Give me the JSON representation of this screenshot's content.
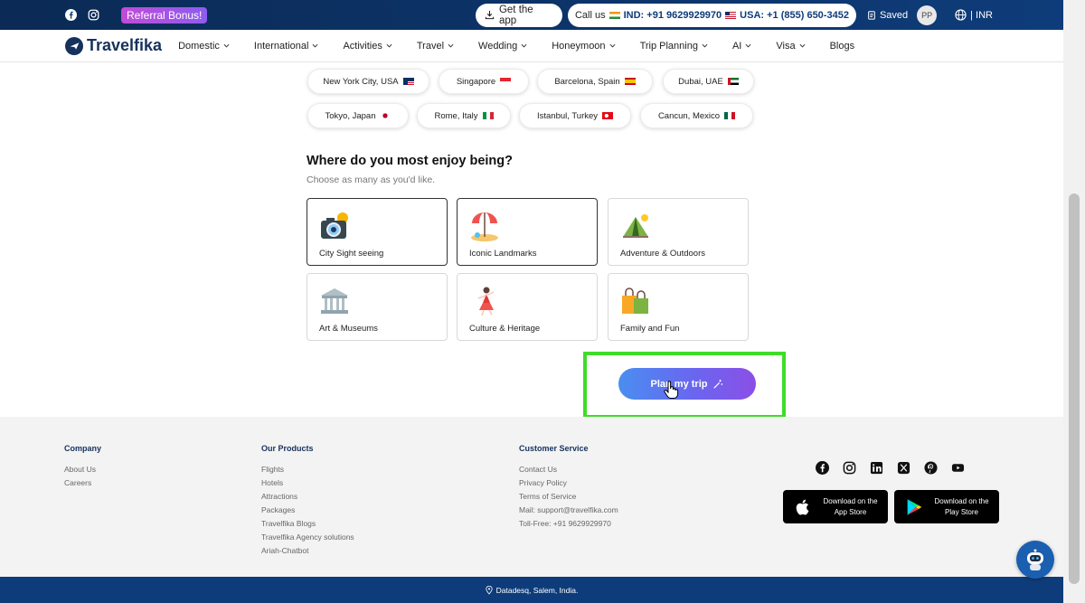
{
  "topbar": {
    "referral_label": "Referral Bonus!",
    "get_app_label": "Get the app",
    "call_us_label": "Call us",
    "ind_phone": "IND: +91 9629929970",
    "usa_phone": "USA: +1 (855) 650-3452",
    "saved_label": "Saved",
    "avatar_initials": "PP",
    "currency_label": "| INR"
  },
  "nav": {
    "logo_text": "Travelfika",
    "items": [
      "Domestic",
      "International",
      "Activities",
      "Travel",
      "Wedding",
      "Honeymoon",
      "Trip Planning",
      "AI",
      "Visa",
      "Blogs"
    ]
  },
  "cities": [
    {
      "label": "New York City, USA",
      "flag": "us"
    },
    {
      "label": "Singapore",
      "flag": "sg"
    },
    {
      "label": "Barcelona, Spain",
      "flag": "es"
    },
    {
      "label": "Dubai, UAE",
      "flag": "ae"
    },
    {
      "label": "Tokyo, Japan",
      "flag": "jp"
    },
    {
      "label": "Rome, Italy",
      "flag": "it"
    },
    {
      "label": "Istanbul, Turkey",
      "flag": "tr"
    },
    {
      "label": "Cancun, Mexico",
      "flag": "mx"
    }
  ],
  "enjoy": {
    "title": "Where do you most enjoy being?",
    "subtitle": "Choose as many as you'd like.",
    "options": [
      {
        "label": "City Sight seeing",
        "icon": "camera-icon",
        "selected": true
      },
      {
        "label": "Iconic Landmarks",
        "icon": "beach-umbrella-icon",
        "selected": true
      },
      {
        "label": "Adventure & Outdoors",
        "icon": "tent-icon",
        "selected": false
      },
      {
        "label": "Art & Museums",
        "icon": "museum-icon",
        "selected": false
      },
      {
        "label": "Culture & Heritage",
        "icon": "dancer-icon",
        "selected": false
      },
      {
        "label": "Family and Fun",
        "icon": "shopping-bags-icon",
        "selected": false
      }
    ]
  },
  "plan_button": {
    "label": "Plan my trip"
  },
  "footer": {
    "company": {
      "title": "Company",
      "links": [
        "About Us",
        "Careers"
      ]
    },
    "products": {
      "title": "Our Products",
      "links": [
        "Flights",
        "Hotels",
        "Attractions",
        "Packages",
        "Travelfika Blogs",
        "Travelfika Agency solutions",
        "Ariah-Chatbot"
      ]
    },
    "service": {
      "title": "Customer Service",
      "links": [
        "Contact Us",
        "Privacy Policy",
        "Terms of Service",
        "Mail: support@travelfika.com",
        "Toll-Free: +91 9629929970"
      ]
    },
    "app_store": {
      "line1": "Download on the",
      "line2": "App Store"
    },
    "play_store": {
      "line1": "Download on the",
      "line2": "Play Store"
    },
    "address": "Datadesq, Salem, India."
  },
  "colors": {
    "brand_navy": "#0e3c7a",
    "highlight_green": "#3fdc29",
    "plan_gradient_start": "#4a8ef0",
    "plan_gradient_end": "#8b4fe6"
  }
}
